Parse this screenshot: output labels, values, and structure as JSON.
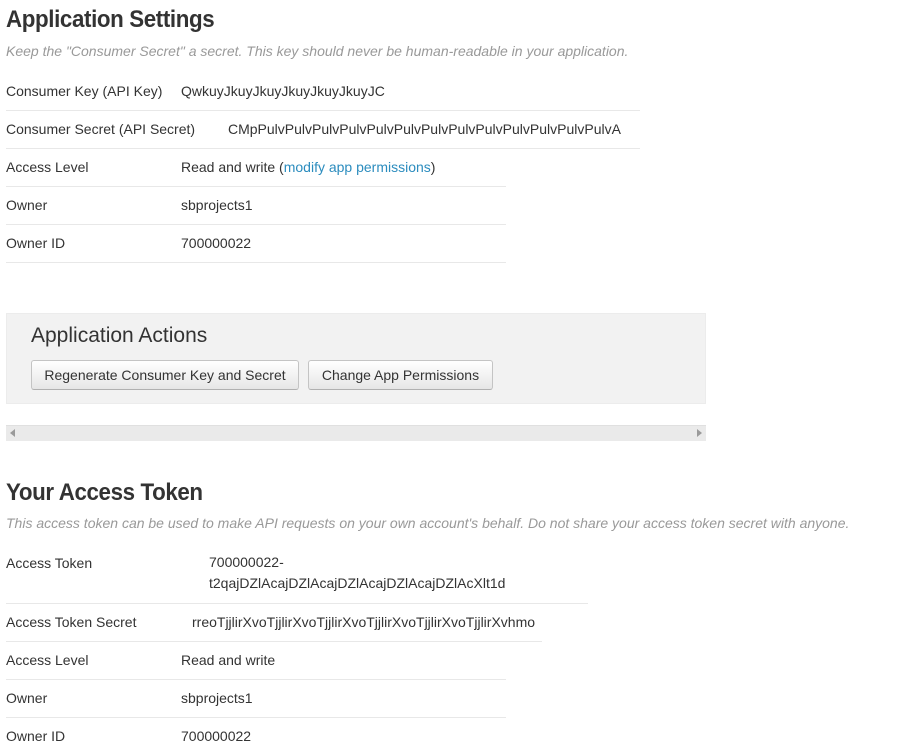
{
  "app_settings": {
    "title": "Application Settings",
    "hint": "Keep the \"Consumer Secret\" a secret. This key should never be human-readable in your application.",
    "consumer_key_label": "Consumer Key (API Key)",
    "consumer_key_value": "QwkuyJkuyJkuyJkuyJkuyJkuyJC",
    "consumer_secret_label": "Consumer Secret (API Secret)",
    "consumer_secret_value": "CMpPulvPulvPulvPulvPulvPulvPulvPulvPulvPulvPulvPulvPulvA",
    "access_level_label": "Access Level",
    "access_level_value": "Read and write",
    "access_level_paren_open": " (",
    "modify_link": "modify app permissions",
    "access_level_paren_close": ")",
    "owner_label": "Owner",
    "owner_value": "sbprojects1",
    "owner_id_label": "Owner ID",
    "owner_id_value": "700000022"
  },
  "app_actions": {
    "title": "Application Actions",
    "regenerate_button": "Regenerate Consumer Key and Secret",
    "change_permissions_button": "Change App Permissions"
  },
  "access_token": {
    "title": "Your Access Token",
    "hint": "This access token can be used to make API requests on your own account's behalf. Do not share your access token secret with anyone.",
    "token_label": "Access Token",
    "token_value_line1": "700000022-",
    "token_value_line2": "t2qajDZlAcajDZlAcajDZlAcajDZlAcajDZlAcXlt1d",
    "token_secret_label": "Access Token Secret",
    "token_secret_value": "rreoTjjlirXvoTjjlirXvoTjjlirXvoTjjlirXvoTjjlirXvoTjjlirXvhmo",
    "access_level_label": "Access Level",
    "access_level_value": "Read and write",
    "owner_label": "Owner",
    "owner_value": "sbprojects1",
    "owner_id_label": "Owner ID",
    "owner_id_value": "700000022"
  },
  "icons": {
    "scroll_left": "triangle-left-icon",
    "scroll_right": "triangle-right-icon"
  },
  "colors": {
    "link": "#2b8cbe",
    "hint": "#999999",
    "text": "#333333",
    "panel": "#f2f2f2"
  }
}
